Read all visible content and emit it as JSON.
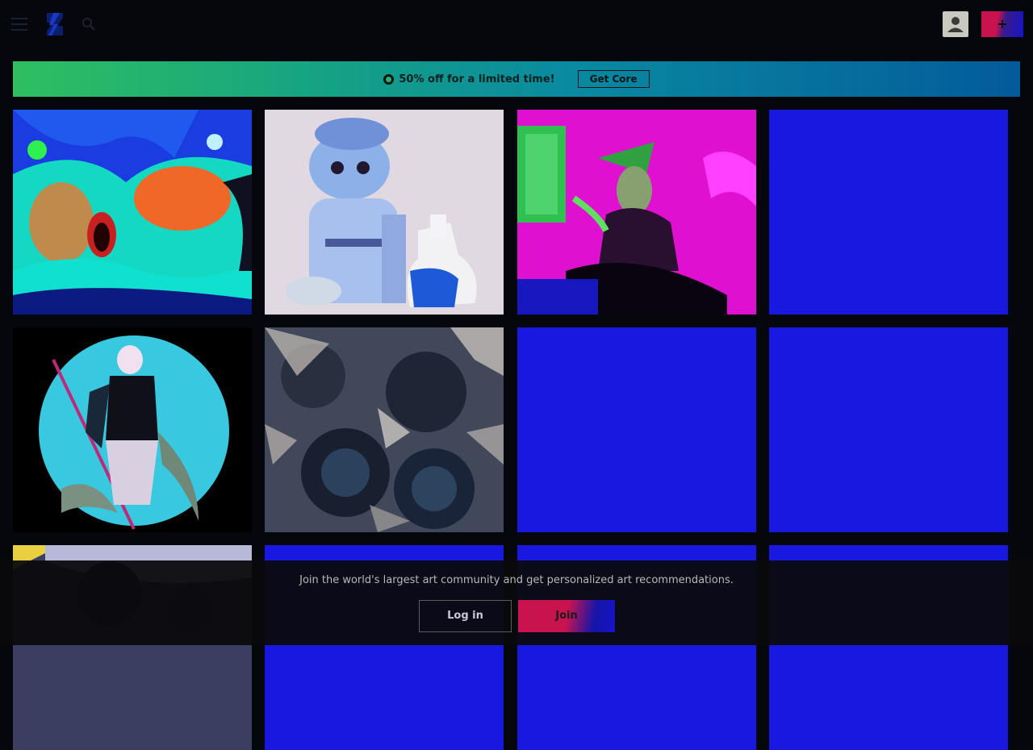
{
  "header": {
    "menu_icon": "hamburger-menu-icon",
    "logo_icon": "deviantart-logo-icon",
    "search_icon": "search-icon",
    "avatar_icon": "user-avatar-icon",
    "submit_label": "+"
  },
  "promo": {
    "icon": "circle-badge-icon",
    "text": "50% off for a limited time!",
    "button_label": "Get Core"
  },
  "gallery": {
    "tiles": [
      {
        "subject": "forest-cave-art",
        "placeholder_color": ""
      },
      {
        "subject": "cat-figurine-photo",
        "placeholder_color": ""
      },
      {
        "subject": "magenta-fantasy-figure",
        "placeholder_color": ""
      },
      {
        "subject": "loading-placeholder",
        "placeholder_color": "#1818e0"
      },
      {
        "subject": "warrior-moon-art",
        "placeholder_color": ""
      },
      {
        "subject": "abstract-flowers",
        "placeholder_color": ""
      },
      {
        "subject": "loading-placeholder",
        "placeholder_color": "#1818e0"
      },
      {
        "subject": "loading-placeholder",
        "placeholder_color": "#1818e0"
      },
      {
        "subject": "dark-texture-art",
        "placeholder_color": ""
      },
      {
        "subject": "loading-placeholder",
        "placeholder_color": "#1818e0"
      },
      {
        "subject": "loading-placeholder",
        "placeholder_color": "#1818e0"
      },
      {
        "subject": "loading-placeholder",
        "placeholder_color": "#1818e0"
      }
    ]
  },
  "join": {
    "text": "Join the world's largest art community and get personalized art recommendations.",
    "login_label": "Log in",
    "join_label": "Join"
  },
  "colors": {
    "background": "#06070d",
    "placeholder": "#1818e0",
    "accent_pink": "#c8134f",
    "promo_green": "#2fbf60",
    "promo_blue": "#035b9a"
  }
}
